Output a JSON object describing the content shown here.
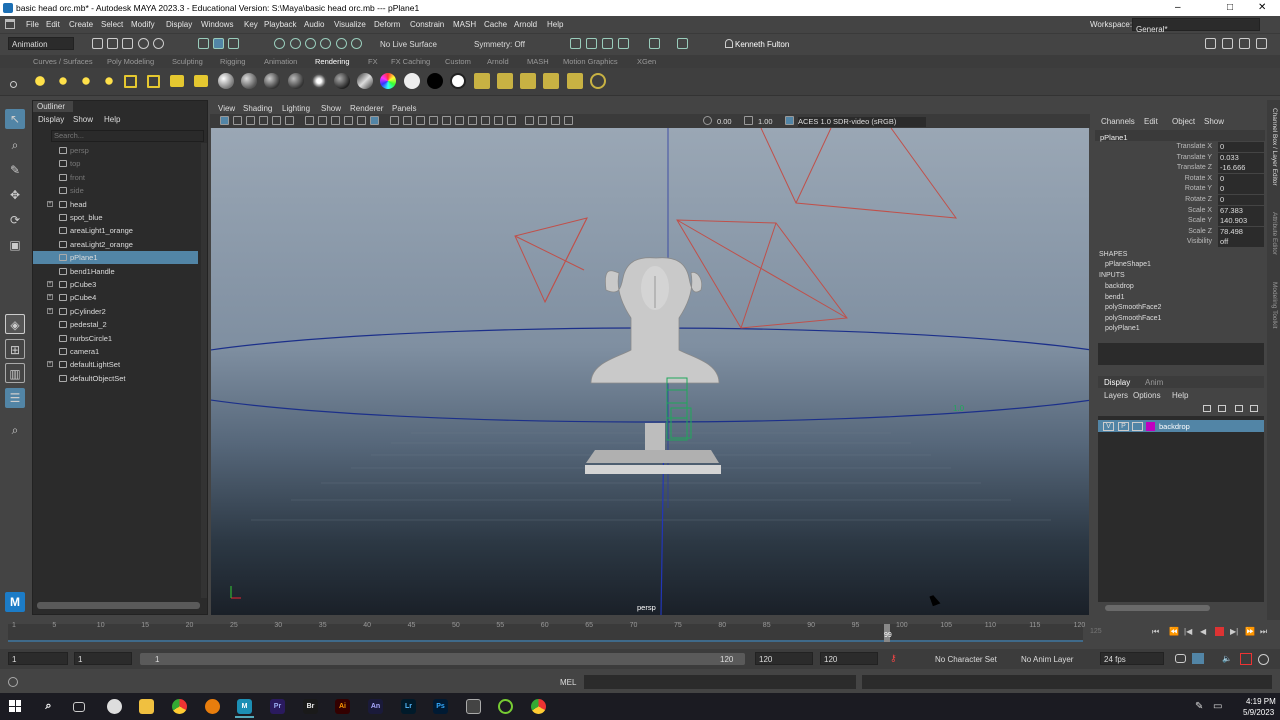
{
  "window": {
    "title": "basic head orc.mb* - Autodesk MAYA 2023.3 - Educational Version: S:\\Maya\\basic head orc.mb   ---   pPlane1",
    "min": "–",
    "max": "□",
    "close": "✕"
  },
  "menubar": [
    "File",
    "Edit",
    "Create",
    "Select",
    "Modify",
    "Display",
    "Windows",
    "Key",
    "Playback",
    "Audio",
    "Visualize",
    "Deform",
    "Constrain",
    "MASH",
    "Cache",
    "Arnold",
    "Help"
  ],
  "workspace": {
    "label": "Workspace:",
    "value": "General*"
  },
  "status": {
    "mode": "Animation",
    "live_surface": "No Live Surface",
    "symmetry": "Symmetry: Off",
    "user": "Kenneth Fulton"
  },
  "shelf_tabs": [
    "Curves / Surfaces",
    "Poly Modeling",
    "Sculpting",
    "Rigging",
    "Animation",
    "Rendering",
    "FX",
    "FX Caching",
    "Custom",
    "Arnold",
    "MASH",
    "Motion Graphics",
    "XGen"
  ],
  "shelf_active": "Rendering",
  "outliner": {
    "tab": "Outliner",
    "menu": [
      "Display",
      "Show",
      "Help"
    ],
    "search_placeholder": "Search...",
    "items": [
      {
        "label": "persp",
        "dim": true
      },
      {
        "label": "top",
        "dim": true
      },
      {
        "label": "front",
        "dim": true
      },
      {
        "label": "side",
        "dim": true
      },
      {
        "label": "head",
        "expand": true
      },
      {
        "label": "spot_blue"
      },
      {
        "label": "areaLight1_orange"
      },
      {
        "label": "areaLight2_orange"
      },
      {
        "label": "pPlane1",
        "selected": true
      },
      {
        "label": "bend1Handle"
      },
      {
        "label": "pCube3",
        "expand": true
      },
      {
        "label": "pCube4",
        "expand": true
      },
      {
        "label": "pCylinder2",
        "expand": true
      },
      {
        "label": "pedestal_2"
      },
      {
        "label": "nurbsCircle1"
      },
      {
        "label": "camera1"
      },
      {
        "label": "defaultLightSet",
        "expand": true
      },
      {
        "label": "defaultObjectSet"
      }
    ]
  },
  "viewport": {
    "menu": [
      "View",
      "Shading",
      "Lighting",
      "Show",
      "Renderer",
      "Panels"
    ],
    "exposure": "0.00",
    "gamma": "1.00",
    "colorspace": "ACES 1.0 SDR-video (sRGB)",
    "camera_label": "persp"
  },
  "channelbox": {
    "menu": [
      "Channels",
      "Edit",
      "Object",
      "Show"
    ],
    "object": "pPlane1",
    "attrs": [
      {
        "name": "Translate X",
        "value": "0"
      },
      {
        "name": "Translate Y",
        "value": "0.033"
      },
      {
        "name": "Translate Z",
        "value": "-16.666"
      },
      {
        "name": "Rotate X",
        "value": "0"
      },
      {
        "name": "Rotate Y",
        "value": "0"
      },
      {
        "name": "Rotate Z",
        "value": "0"
      },
      {
        "name": "Scale X",
        "value": "67.383"
      },
      {
        "name": "Scale Y",
        "value": "140.903"
      },
      {
        "name": "Scale Z",
        "value": "78.498"
      },
      {
        "name": "Visibility",
        "value": "off"
      }
    ],
    "shapes_header": "SHAPES",
    "shapes": [
      "pPlaneShape1"
    ],
    "inputs_header": "INPUTS",
    "inputs": [
      "backdrop",
      "bend1",
      "polySmoothFace2",
      "polySmoothFace1",
      "polyPlane1"
    ]
  },
  "layers": {
    "tabs": [
      "Display",
      "Anim"
    ],
    "menu": [
      "Layers",
      "Options",
      "Help"
    ],
    "layer": {
      "v": "V",
      "p": "P",
      "name": "backdrop",
      "color": "#c000c0"
    }
  },
  "side_tabs": [
    "Channel Box / Layer Editor",
    "Attribute Editor",
    "Modeling Toolkit"
  ],
  "timeline": {
    "ticks": [
      "1",
      "5",
      "10",
      "15",
      "20",
      "25",
      "30",
      "35",
      "40",
      "45",
      "50",
      "55",
      "60",
      "65",
      "70",
      "75",
      "80",
      "85",
      "90",
      "95",
      "100",
      "105",
      "110",
      "115",
      "120"
    ],
    "current": "99",
    "end_dim": "125"
  },
  "range": {
    "start": "1",
    "start2": "1",
    "slider_start": "1",
    "slider_end": "120",
    "end": "120",
    "end2": "120",
    "char_set": "No Character Set",
    "anim_layer": "No Anim Layer",
    "fps": "24 fps"
  },
  "cmdline": {
    "lang": "MEL"
  },
  "taskbar": {
    "apps": [
      "Pr",
      "Br",
      "Ai",
      "An",
      "Lr",
      "Ps"
    ],
    "time": "4:19 PM",
    "date": "5/9/2023"
  },
  "colors": {
    "selection": "#5285a6",
    "panel": "#444444",
    "dark": "#2b2b2b",
    "light_orange": "#c0504a"
  }
}
